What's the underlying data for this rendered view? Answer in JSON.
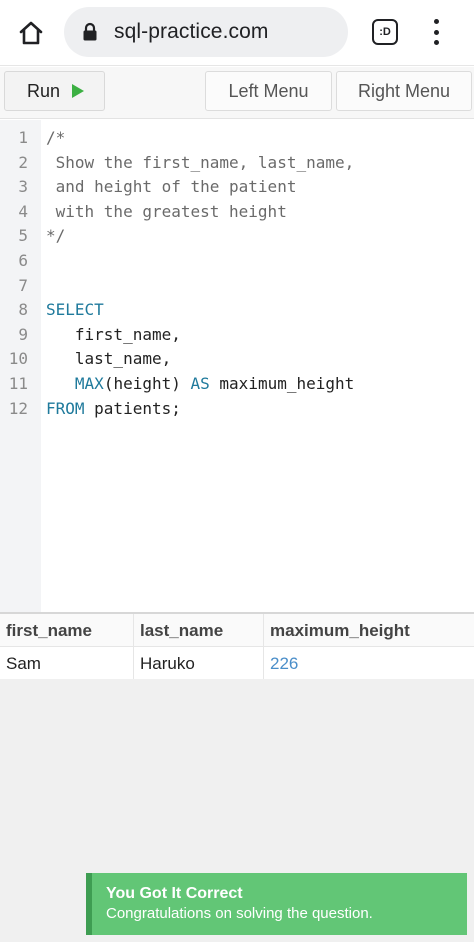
{
  "browser": {
    "url": "sql-practice.com",
    "tab_label": ":D"
  },
  "toolbar": {
    "run_label": "Run",
    "left_menu_label": "Left Menu",
    "right_menu_label": "Right Menu"
  },
  "editor": {
    "lines": [
      {
        "num": "1",
        "segments": [
          {
            "text": "/*",
            "cls": "comment"
          }
        ]
      },
      {
        "num": "2",
        "segments": [
          {
            "text": " Show the first_name, last_name,",
            "cls": "comment"
          }
        ]
      },
      {
        "num": "3",
        "segments": [
          {
            "text": " and height of the patient",
            "cls": "comment"
          }
        ]
      },
      {
        "num": "4",
        "segments": [
          {
            "text": " with the greatest height",
            "cls": "comment"
          }
        ]
      },
      {
        "num": "5",
        "segments": [
          {
            "text": "*/",
            "cls": "comment"
          }
        ]
      },
      {
        "num": "6",
        "segments": []
      },
      {
        "num": "7",
        "segments": []
      },
      {
        "num": "8",
        "segments": [
          {
            "text": "SELECT",
            "cls": "kw"
          }
        ]
      },
      {
        "num": "9",
        "segments": [
          {
            "text": "   first_name,",
            "cls": ""
          }
        ]
      },
      {
        "num": "10",
        "segments": [
          {
            "text": "   last_name,",
            "cls": ""
          }
        ]
      },
      {
        "num": "11",
        "segments": [
          {
            "text": "   ",
            "cls": ""
          },
          {
            "text": "MAX",
            "cls": "kw"
          },
          {
            "text": "(height) ",
            "cls": ""
          },
          {
            "text": "AS",
            "cls": "kw"
          },
          {
            "text": " maximum_height",
            "cls": ""
          }
        ]
      },
      {
        "num": "12",
        "segments": [
          {
            "text": "FROM",
            "cls": "kw"
          },
          {
            "text": " patients;",
            "cls": ""
          }
        ]
      }
    ]
  },
  "results": {
    "columns": [
      "first_name",
      "last_name",
      "maximum_height"
    ],
    "rows": [
      [
        "Sam",
        "Haruko",
        "226"
      ]
    ]
  },
  "toast": {
    "title": "You Got It Correct",
    "message": "Congratulations on solving the question."
  },
  "colors": {
    "keyword": "#1f7a9c",
    "run_play": "#3cb043",
    "toast_bg": "#62c676",
    "numeric_value": "#4a8ec9"
  },
  "icons": {
    "home": "home-icon",
    "lock": "lock-icon",
    "menu": "more-vert-icon",
    "run": "play-icon"
  }
}
